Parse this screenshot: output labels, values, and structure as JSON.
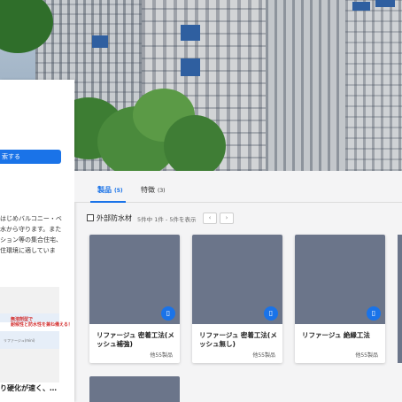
{
  "left_panel": {
    "button_label": "索する",
    "description": "はじめバルコニー・ベ\n水から守ります。また\nション等の集合住宅、\n住環境に適していま",
    "thumbnail": {
      "title": "無溶剤型で\n耐候性と防水性を兼ね備える！",
      "caption": "リファージュ(mini)"
    },
    "article_title": "り硬化が速く、…"
  },
  "tabs": [
    {
      "label": "製品",
      "count": "(5)",
      "active": true
    },
    {
      "label": "特徴",
      "count": "(3)",
      "active": false
    }
  ],
  "filter": {
    "category_label": "外部防水材",
    "result_text": "5件中 1件 - 5件を表示",
    "prev_icon": "‹",
    "next_icon": "›"
  },
  "products": [
    {
      "name": "リファージュ 密着工法(メッシュ補強)",
      "more": "他55製品",
      "badge_icon": "document-icon"
    },
    {
      "name": "リファージュ 密着工法(メッシュ無し)",
      "more": "他55製品",
      "badge_icon": "document-icon"
    },
    {
      "name": "リファージュ 絶縁工法",
      "more": "他55製品",
      "badge_icon": "document-icon"
    }
  ],
  "colors": {
    "accent": "#1a73e8",
    "card_image": "#6b758a"
  }
}
